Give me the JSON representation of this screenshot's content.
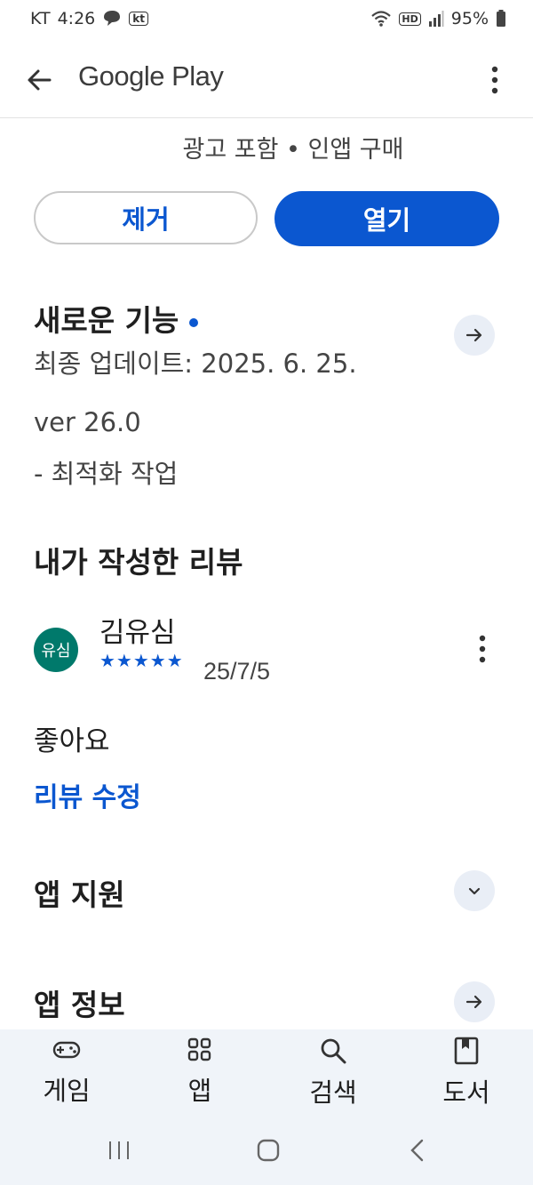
{
  "status": {
    "carrier": "KT",
    "time": "4:26",
    "kt_badge": "kt",
    "hd_badge": "HD",
    "battery": "95%"
  },
  "appbar": {
    "title": "Google Play"
  },
  "app": {
    "sub_info": "광고 포함 • 인앱 구매",
    "remove_label": "제거",
    "open_label": "열기"
  },
  "whats_new": {
    "title": "새로운 기능",
    "updated": "최종 업데이트: 2025. 6. 25.",
    "version": "ver 26.0",
    "note": "- 최적화 작업"
  },
  "my_review": {
    "title": "내가 작성한 리뷰",
    "avatar_text": "유심",
    "author": "김유심",
    "stars": "★★★★★",
    "rating": 5,
    "date": "25/7/5",
    "text": "좋아요",
    "edit_label": "리뷰 수정"
  },
  "app_support": {
    "title": "앱 지원"
  },
  "app_info": {
    "title": "앱 정보"
  },
  "bottom_nav": {
    "items": [
      {
        "label": "게임",
        "icon": "gamepad-icon"
      },
      {
        "label": "앱",
        "icon": "apps-grid-icon"
      },
      {
        "label": "검색",
        "icon": "search-icon"
      },
      {
        "label": "도서",
        "icon": "book-icon"
      }
    ]
  },
  "colors": {
    "accent": "#0b57d0",
    "avatar_bg": "#00796b",
    "nav_bg": "#f0f4f9"
  }
}
